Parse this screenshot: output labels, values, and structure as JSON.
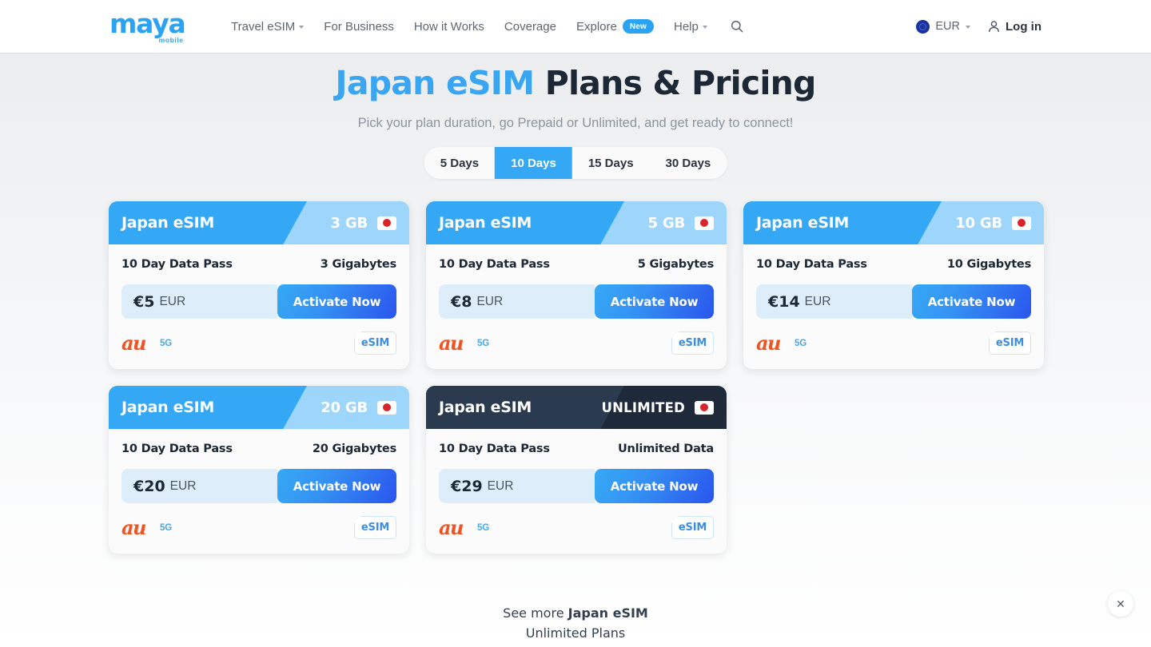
{
  "nav": {
    "logo_word": "maya",
    "logo_sub": "mobile",
    "links": [
      {
        "label": "Travel eSIM",
        "caret": true,
        "badge": null
      },
      {
        "label": "For Business",
        "caret": false,
        "badge": null
      },
      {
        "label": "How it Works",
        "caret": false,
        "badge": null
      },
      {
        "label": "Coverage",
        "caret": false,
        "badge": null
      },
      {
        "label": "Explore",
        "caret": false,
        "badge": "New"
      },
      {
        "label": "Help",
        "caret": true,
        "badge": null
      }
    ],
    "search_icon": "search-icon",
    "currency": "EUR",
    "login": "Log in"
  },
  "hero": {
    "title_accent": "Japan eSIM",
    "title_rest": " Plans & Pricing",
    "subtitle": "Pick your plan duration, go Prepaid or Unlimited, and get ready to connect!"
  },
  "duration_tabs": {
    "options": [
      "5 Days",
      "10 Days",
      "15 Days",
      "30 Days"
    ],
    "selected": "10 Days"
  },
  "cards": [
    {
      "title": "Japan eSIM",
      "size": "3 GB",
      "dark": false,
      "duration": "10 Day Data Pass",
      "data": "3 Gigabytes",
      "price_amount": "€5",
      "price_currency": "EUR",
      "cta": "Activate Now",
      "carrier": "au",
      "network": "5G",
      "sim_badge": "eSIM",
      "flag": "japan-flag-icon"
    },
    {
      "title": "Japan eSIM",
      "size": "5 GB",
      "dark": false,
      "duration": "10 Day Data Pass",
      "data": "5 Gigabytes",
      "price_amount": "€8",
      "price_currency": "EUR",
      "cta": "Activate Now",
      "carrier": "au",
      "network": "5G",
      "sim_badge": "eSIM",
      "flag": "japan-flag-icon"
    },
    {
      "title": "Japan eSIM",
      "size": "10 GB",
      "dark": false,
      "duration": "10 Day Data Pass",
      "data": "10 Gigabytes",
      "price_amount": "€14",
      "price_currency": "EUR",
      "cta": "Activate Now",
      "carrier": "au",
      "network": "5G",
      "sim_badge": "eSIM",
      "flag": "japan-flag-icon"
    },
    {
      "title": "Japan eSIM",
      "size": "20 GB",
      "dark": false,
      "duration": "10 Day Data Pass",
      "data": "20 Gigabytes",
      "price_amount": "€20",
      "price_currency": "EUR",
      "cta": "Activate Now",
      "carrier": "au",
      "network": "5G",
      "sim_badge": "eSIM",
      "flag": "japan-flag-icon"
    },
    {
      "title": "Japan eSIM",
      "size": "UNLIMITED",
      "dark": true,
      "duration": "10 Day Data Pass",
      "data": "Unlimited Data",
      "price_amount": "€29",
      "price_currency": "EUR",
      "cta": "Activate Now",
      "carrier": "au",
      "network": "5G",
      "sim_badge": "eSIM",
      "flag": "japan-flag-icon"
    }
  ],
  "see_more": {
    "prefix": "See more ",
    "bold": "Japan eSIM",
    "line2": "Unlimited Plans"
  },
  "close_button": "✕",
  "colors": {
    "brand_blue": "#2ba2f2",
    "accent_light_blue": "#9ed5fb",
    "dark_navy": "#1e2a3a",
    "carrier_orange": "#ef5523",
    "flag_red": "#d8252a"
  }
}
